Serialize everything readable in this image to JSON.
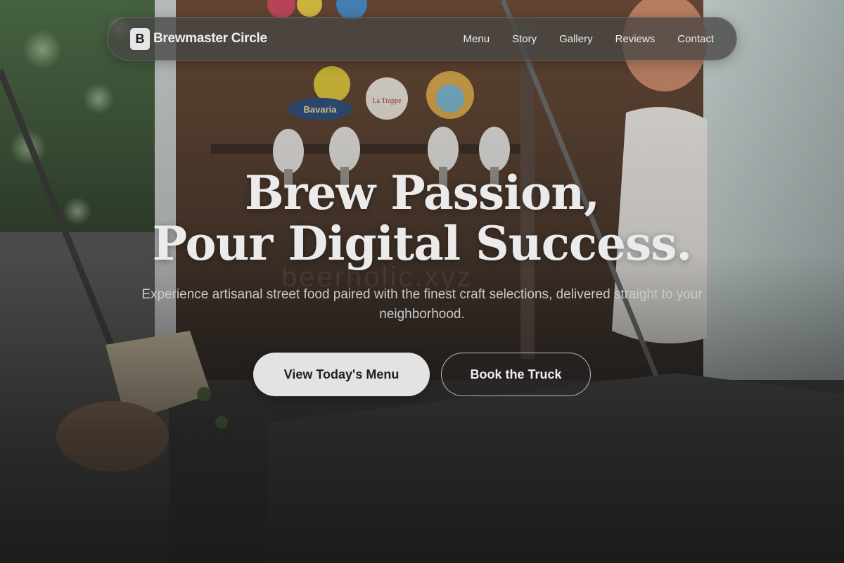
{
  "nav": {
    "brand_mark": "B",
    "brand_name": "Brewmaster Circle",
    "links": [
      "Menu",
      "Story",
      "Gallery",
      "Reviews",
      "Contact"
    ]
  },
  "hero": {
    "title_line1": "Brew Passion,",
    "title_line2": "Pour Digital Success.",
    "subtitle": "Experience artisanal street food paired with the finest craft selections, delivered straight to your neighborhood.",
    "primary_cta": "View Today's Menu",
    "secondary_cta": "Book the Truck"
  },
  "background": {
    "watermark": "beerholic.xyz",
    "tap_badges": [
      "Bavaria",
      "La Trappe"
    ]
  },
  "colors": {
    "page_background": "#1c1c1c",
    "nav_background": "#484644",
    "primary_button": "#e3e3e3",
    "text_light": "#ebebeb"
  }
}
